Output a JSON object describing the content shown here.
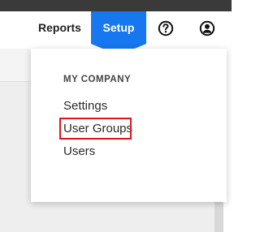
{
  "navbar": {
    "reports_label": "Reports",
    "setup_label": "Setup",
    "help_icon": "help-circle-icon",
    "user_icon": "user-account-icon",
    "accent_color": "#1677ee"
  },
  "dropdown": {
    "section_title": "MY COMPANY",
    "items": [
      {
        "label": "Settings"
      },
      {
        "label": "User Groups",
        "highlighted": true
      },
      {
        "label": "Users"
      }
    ],
    "highlight_color": "#e0141e"
  }
}
